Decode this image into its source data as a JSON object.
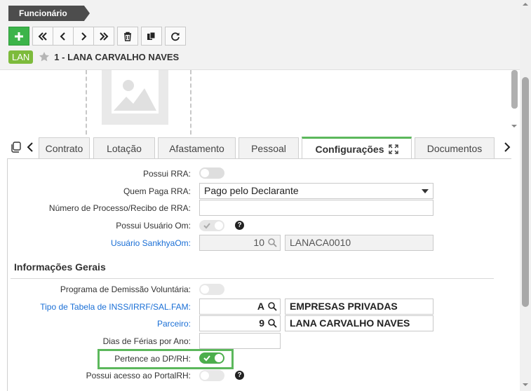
{
  "header": {
    "title": "Funcionário",
    "badge": "LAN",
    "record_title": "1 - LANA CARVALHO NAVES"
  },
  "toolbar": {
    "buttons": [
      "add-icon",
      "first-icon",
      "prev-icon",
      "next-icon",
      "last-icon",
      "trash-icon",
      "copy-icon",
      "refresh-icon"
    ]
  },
  "tabs": [
    {
      "label": "Contrato",
      "active": false
    },
    {
      "label": "Lotação",
      "active": false
    },
    {
      "label": "Afastamento",
      "active": false
    },
    {
      "label": "Pessoal",
      "active": false
    },
    {
      "label": "Configurações",
      "active": true
    },
    {
      "label": "Documentos",
      "active": false
    }
  ],
  "form": {
    "possui_rra": {
      "label": "Possui RRA:",
      "value": false
    },
    "quem_paga_rra": {
      "label": "Quem Paga RRA:",
      "value": "Pago pelo Declarante"
    },
    "numero_processo": {
      "label": "Número de Processo/Recibo de RRA:",
      "value": ""
    },
    "possui_usuario_om": {
      "label": "Possui Usuário Om:",
      "value": true
    },
    "usuario_sankhya": {
      "label": "Usuário SankhyaOm:",
      "code": "10",
      "description": "LANACA0010"
    },
    "section_title": "Informações Gerais",
    "programa_demissao": {
      "label": "Programa de Demissão Voluntária:",
      "value": false
    },
    "tipo_tabela": {
      "label": "Tipo de Tabela de INSS/IRRF/SAL.FAM:",
      "code": "A",
      "description": "EMPRESAS PRIVADAS"
    },
    "parceiro": {
      "label": "Parceiro:",
      "code": "9",
      "description": "LANA CARVALHO NAVES"
    },
    "dias_ferias": {
      "label": "Dias de Férias por Ano:",
      "value": ""
    },
    "pertence_dp": {
      "label": "Pertence ao DP/RH:",
      "value": true
    },
    "possui_portal": {
      "label": "Possui acesso ao PortalRH:",
      "value": false
    }
  },
  "colors": {
    "accent": "#5cb85c",
    "link": "#1a6fd6",
    "badge": "#7dbb3c"
  }
}
